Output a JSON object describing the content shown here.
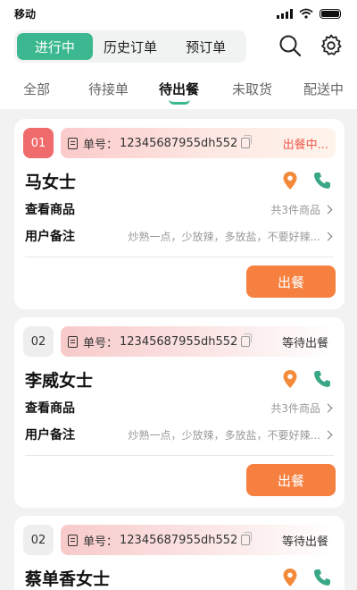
{
  "statusbar": {
    "carrier": "移动"
  },
  "header": {
    "segments": [
      "进行中",
      "历史订单",
      "预订单"
    ],
    "active_segment": 0
  },
  "tabs": [
    "全部",
    "待接单",
    "待出餐",
    "未取货",
    "配送中"
  ],
  "active_tab": 2,
  "colors": {
    "accent": "#3bb88f",
    "action": "#f58040",
    "alert": "#f2584d"
  },
  "orders": [
    {
      "index": "01",
      "order_label": "单号：",
      "order_no": "12345687955dh552",
      "status": "出餐中...",
      "name": "马女士",
      "goods_label": "查看商品",
      "goods_value": "共3件商品",
      "note_label": "用户备注",
      "note_value": "炒熟一点，少放辣，多放盐，不要好辣...",
      "button": "出餐"
    },
    {
      "index": "02",
      "order_label": "单号：",
      "order_no": "12345687955dh552",
      "status": "等待出餐",
      "name": "李威女士",
      "goods_label": "查看商品",
      "goods_value": "共3件商品",
      "note_label": "用户备注",
      "note_value": "炒熟一点，少放辣，多放盐，不要好辣...",
      "button": "出餐"
    },
    {
      "index": "02",
      "order_label": "单号：",
      "order_no": "12345687955dh552",
      "status": "等待出餐",
      "name": "蔡单香女士"
    }
  ]
}
